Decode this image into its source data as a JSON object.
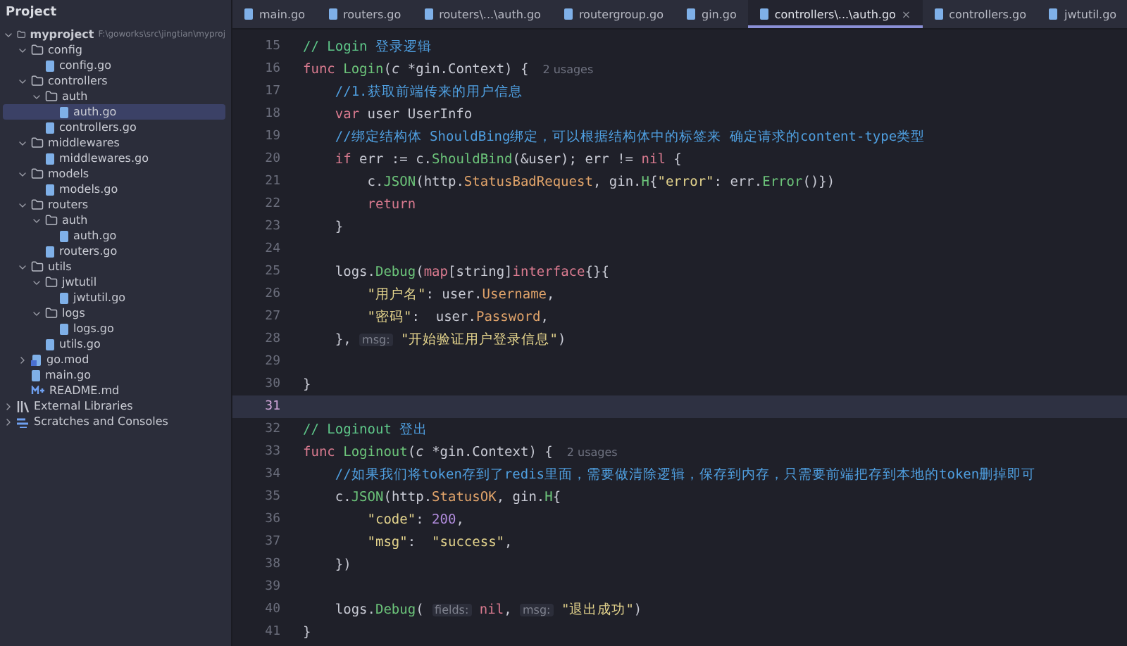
{
  "sidebar": {
    "title": "Project",
    "tree": [
      {
        "kind": "folder",
        "name": "myproject",
        "path": "F:\\goworks\\src\\jingtian\\myproj",
        "expanded": true,
        "selected": false,
        "children": [
          {
            "kind": "folder",
            "name": "config",
            "expanded": true,
            "selected": false,
            "children": [
              {
                "kind": "gofile",
                "name": "config.go",
                "selected": false
              }
            ]
          },
          {
            "kind": "folder",
            "name": "controllers",
            "expanded": true,
            "selected": false,
            "children": [
              {
                "kind": "folder",
                "name": "auth",
                "expanded": true,
                "selected": false,
                "children": [
                  {
                    "kind": "gofile",
                    "name": "auth.go",
                    "selected": true
                  }
                ]
              },
              {
                "kind": "gofile",
                "name": "controllers.go",
                "selected": false
              }
            ]
          },
          {
            "kind": "folder",
            "name": "middlewares",
            "expanded": true,
            "selected": false,
            "children": [
              {
                "kind": "gofile",
                "name": "middlewares.go",
                "selected": false
              }
            ]
          },
          {
            "kind": "folder",
            "name": "models",
            "expanded": true,
            "selected": false,
            "children": [
              {
                "kind": "gofile",
                "name": "models.go",
                "selected": false
              }
            ]
          },
          {
            "kind": "folder",
            "name": "routers",
            "expanded": true,
            "selected": false,
            "children": [
              {
                "kind": "folder",
                "name": "auth",
                "expanded": true,
                "selected": false,
                "children": [
                  {
                    "kind": "gofile",
                    "name": "auth.go",
                    "selected": false
                  }
                ]
              },
              {
                "kind": "gofile",
                "name": "routers.go",
                "selected": false
              }
            ]
          },
          {
            "kind": "folder",
            "name": "utils",
            "expanded": true,
            "selected": false,
            "children": [
              {
                "kind": "folder",
                "name": "jwtutil",
                "expanded": true,
                "selected": false,
                "children": [
                  {
                    "kind": "gofile",
                    "name": "jwtutil.go",
                    "selected": false
                  }
                ]
              },
              {
                "kind": "folder",
                "name": "logs",
                "expanded": true,
                "selected": false,
                "children": [
                  {
                    "kind": "gofile",
                    "name": "logs.go",
                    "selected": false
                  }
                ]
              },
              {
                "kind": "gofile",
                "name": "utils.go",
                "selected": false
              }
            ]
          },
          {
            "kind": "mod",
            "name": "go.mod",
            "expanded": false,
            "selected": false
          },
          {
            "kind": "gofile",
            "name": "main.go",
            "selected": false
          },
          {
            "kind": "md",
            "name": "README.md",
            "selected": false
          }
        ]
      },
      {
        "kind": "library",
        "name": "External Libraries",
        "expanded": false,
        "selected": false
      },
      {
        "kind": "scratches",
        "name": "Scratches and Consoles",
        "expanded": false,
        "selected": false
      }
    ]
  },
  "tabs": [
    {
      "label": "main.go",
      "selected": false
    },
    {
      "label": "routers.go",
      "selected": false
    },
    {
      "label": "routers\\...\\auth.go",
      "selected": false
    },
    {
      "label": "routergroup.go",
      "selected": false
    },
    {
      "label": "gin.go",
      "selected": false
    },
    {
      "label": "controllers\\...\\auth.go",
      "selected": true,
      "close": "×"
    },
    {
      "label": "controllers.go",
      "selected": false
    },
    {
      "label": "jwtutil.go",
      "selected": false
    }
  ],
  "editor": {
    "lines": [
      {
        "number": "15",
        "current": false,
        "tokens": [
          {
            "kind": "doc",
            "text": "// Login "
          },
          {
            "kind": "cmt",
            "text": "登录逻辑"
          }
        ]
      },
      {
        "number": "16",
        "current": false,
        "tokens": [
          {
            "kind": "kw",
            "text": "func "
          },
          {
            "kind": "fn",
            "text": "Login"
          },
          {
            "kind": "p",
            "text": "("
          },
          {
            "kind": "param",
            "text": "c"
          },
          {
            "kind": "p",
            "text": " *gin.Context) {"
          },
          {
            "kind": "usage",
            "text": "2 usages"
          }
        ]
      },
      {
        "number": "17",
        "current": false,
        "tokens": [
          {
            "kind": "cmt",
            "text": "    //1.获取前端传来的用户信息"
          }
        ]
      },
      {
        "number": "18",
        "current": false,
        "tokens": [
          {
            "kind": "kw",
            "text": "    var "
          },
          {
            "kind": "p",
            "text": "user UserInfo"
          }
        ]
      },
      {
        "number": "19",
        "current": false,
        "tokens": [
          {
            "kind": "cmt",
            "text": "    //绑定结构体 ShouldBing绑定，可以根据结构体中的标签来 确定请求的content-type类型"
          }
        ]
      },
      {
        "number": "20",
        "current": false,
        "tokens": [
          {
            "kind": "kw",
            "text": "    if "
          },
          {
            "kind": "p",
            "text": "err := c."
          },
          {
            "kind": "fn",
            "text": "ShouldBind"
          },
          {
            "kind": "p",
            "text": "(&user); err != "
          },
          {
            "kind": "kw",
            "text": "nil"
          },
          {
            "kind": "p",
            "text": " {"
          }
        ]
      },
      {
        "number": "21",
        "current": false,
        "tokens": [
          {
            "kind": "p",
            "text": "        c."
          },
          {
            "kind": "fn",
            "text": "JSON"
          },
          {
            "kind": "p",
            "text": "(http."
          },
          {
            "kind": "field",
            "text": "StatusBadRequest"
          },
          {
            "kind": "p",
            "text": ", gin."
          },
          {
            "kind": "fn",
            "text": "H"
          },
          {
            "kind": "p",
            "text": "{"
          },
          {
            "kind": "str",
            "text": "\"error\""
          },
          {
            "kind": "p",
            "text": ": err."
          },
          {
            "kind": "fn",
            "text": "Error"
          },
          {
            "kind": "p",
            "text": "()})"
          }
        ]
      },
      {
        "number": "22",
        "current": false,
        "tokens": [
          {
            "kind": "kw",
            "text": "        return"
          }
        ]
      },
      {
        "number": "23",
        "current": false,
        "tokens": [
          {
            "kind": "p",
            "text": "    }"
          }
        ]
      },
      {
        "number": "24",
        "current": false
      },
      {
        "number": "25",
        "current": false,
        "tokens": [
          {
            "kind": "p",
            "text": "    logs."
          },
          {
            "kind": "fn",
            "text": "Debug"
          },
          {
            "kind": "p",
            "text": "("
          },
          {
            "kind": "kw",
            "text": "map"
          },
          {
            "kind": "p",
            "text": "[string]"
          },
          {
            "kind": "kw",
            "text": "interface"
          },
          {
            "kind": "p",
            "text": "{}{"
          }
        ]
      },
      {
        "number": "26",
        "current": false,
        "tokens": [
          {
            "kind": "str",
            "text": "        \"用户名\""
          },
          {
            "kind": "p",
            "text": ": user."
          },
          {
            "kind": "field",
            "text": "Username"
          },
          {
            "kind": "p",
            "text": ","
          }
        ]
      },
      {
        "number": "27",
        "current": false,
        "tokens": [
          {
            "kind": "str",
            "text": "        \"密码\""
          },
          {
            "kind": "p",
            "text": ":  user."
          },
          {
            "kind": "field",
            "text": "Password"
          },
          {
            "kind": "p",
            "text": ","
          }
        ]
      },
      {
        "number": "28",
        "current": false,
        "tokens": [
          {
            "kind": "p",
            "text": "    }, "
          },
          {
            "kind": "hint",
            "text": "msg:"
          },
          {
            "kind": "str",
            "text": " \"开始验证用户登录信息\""
          },
          {
            "kind": "p",
            "text": ")"
          }
        ]
      },
      {
        "number": "29",
        "current": false
      },
      {
        "number": "30",
        "current": false,
        "tokens": [
          {
            "kind": "p",
            "text": "}"
          }
        ]
      },
      {
        "number": "31",
        "current": true
      },
      {
        "number": "32",
        "current": false,
        "tokens": [
          {
            "kind": "doc",
            "text": "// Loginout "
          },
          {
            "kind": "cmt",
            "text": "登出"
          }
        ]
      },
      {
        "number": "33",
        "current": false,
        "tokens": [
          {
            "kind": "kw",
            "text": "func "
          },
          {
            "kind": "fn",
            "text": "Loginout"
          },
          {
            "kind": "p",
            "text": "("
          },
          {
            "kind": "param",
            "text": "c"
          },
          {
            "kind": "p",
            "text": " *gin.Context) {"
          },
          {
            "kind": "usage",
            "text": "2 usages"
          }
        ]
      },
      {
        "number": "34",
        "current": false,
        "tokens": [
          {
            "kind": "cmt",
            "text": "    //如果我们将token存到了redis里面，需要做清除逻辑，保存到内存，只需要前端把存到本地的token删掉即可"
          }
        ]
      },
      {
        "number": "35",
        "current": false,
        "tokens": [
          {
            "kind": "p",
            "text": "    c."
          },
          {
            "kind": "fn",
            "text": "JSON"
          },
          {
            "kind": "p",
            "text": "(http."
          },
          {
            "kind": "field",
            "text": "StatusOK"
          },
          {
            "kind": "p",
            "text": ", gin."
          },
          {
            "kind": "fn",
            "text": "H"
          },
          {
            "kind": "p",
            "text": "{"
          }
        ]
      },
      {
        "number": "36",
        "current": false,
        "tokens": [
          {
            "kind": "str",
            "text": "        \"code\""
          },
          {
            "kind": "p",
            "text": ": "
          },
          {
            "kind": "num",
            "text": "200"
          },
          {
            "kind": "p",
            "text": ","
          }
        ]
      },
      {
        "number": "37",
        "current": false,
        "tokens": [
          {
            "kind": "str",
            "text": "        \"msg\""
          },
          {
            "kind": "p",
            "text": ":  "
          },
          {
            "kind": "str",
            "text": "\"success\""
          },
          {
            "kind": "p",
            "text": ","
          }
        ]
      },
      {
        "number": "38",
        "current": false,
        "tokens": [
          {
            "kind": "p",
            "text": "    })"
          }
        ]
      },
      {
        "number": "39",
        "current": false
      },
      {
        "number": "40",
        "current": false,
        "tokens": [
          {
            "kind": "p",
            "text": "    logs."
          },
          {
            "kind": "fn",
            "text": "Debug"
          },
          {
            "kind": "p",
            "text": "( "
          },
          {
            "kind": "hint",
            "text": "fields:"
          },
          {
            "kind": "kw",
            "text": " nil"
          },
          {
            "kind": "p",
            "text": ", "
          },
          {
            "kind": "hint",
            "text": "msg:"
          },
          {
            "kind": "str",
            "text": " \"退出成功\""
          },
          {
            "kind": "p",
            "text": ")"
          }
        ]
      },
      {
        "number": "41",
        "current": false,
        "tokens": [
          {
            "kind": "p",
            "text": "}"
          }
        ]
      }
    ]
  }
}
